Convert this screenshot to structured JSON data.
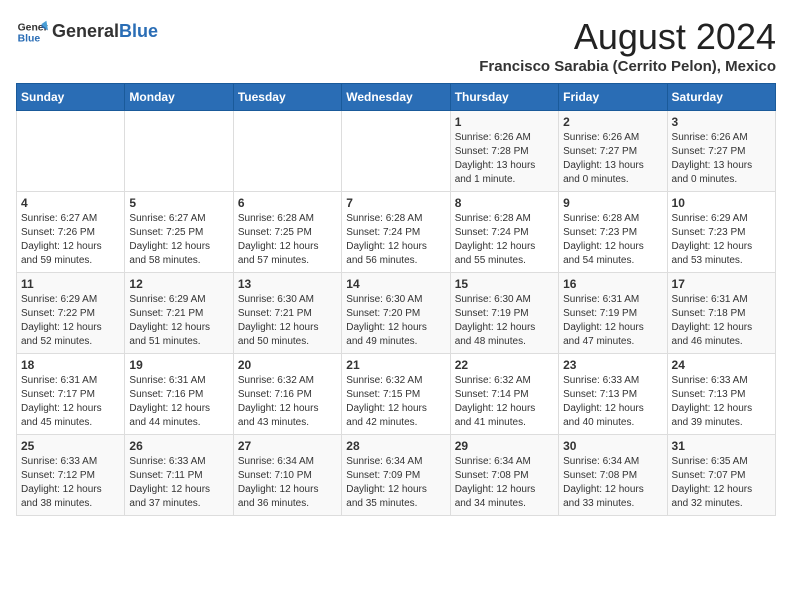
{
  "header": {
    "logo_general": "General",
    "logo_blue": "Blue",
    "month_year": "August 2024",
    "location": "Francisco Sarabia (Cerrito Pelon), Mexico"
  },
  "calendar": {
    "days_of_week": [
      "Sunday",
      "Monday",
      "Tuesday",
      "Wednesday",
      "Thursday",
      "Friday",
      "Saturday"
    ],
    "weeks": [
      [
        {
          "day": "",
          "info": ""
        },
        {
          "day": "",
          "info": ""
        },
        {
          "day": "",
          "info": ""
        },
        {
          "day": "",
          "info": ""
        },
        {
          "day": "1",
          "info": "Sunrise: 6:26 AM\nSunset: 7:28 PM\nDaylight: 13 hours\nand 1 minute."
        },
        {
          "day": "2",
          "info": "Sunrise: 6:26 AM\nSunset: 7:27 PM\nDaylight: 13 hours\nand 0 minutes."
        },
        {
          "day": "3",
          "info": "Sunrise: 6:26 AM\nSunset: 7:27 PM\nDaylight: 13 hours\nand 0 minutes."
        }
      ],
      [
        {
          "day": "4",
          "info": "Sunrise: 6:27 AM\nSunset: 7:26 PM\nDaylight: 12 hours\nand 59 minutes."
        },
        {
          "day": "5",
          "info": "Sunrise: 6:27 AM\nSunset: 7:25 PM\nDaylight: 12 hours\nand 58 minutes."
        },
        {
          "day": "6",
          "info": "Sunrise: 6:28 AM\nSunset: 7:25 PM\nDaylight: 12 hours\nand 57 minutes."
        },
        {
          "day": "7",
          "info": "Sunrise: 6:28 AM\nSunset: 7:24 PM\nDaylight: 12 hours\nand 56 minutes."
        },
        {
          "day": "8",
          "info": "Sunrise: 6:28 AM\nSunset: 7:24 PM\nDaylight: 12 hours\nand 55 minutes."
        },
        {
          "day": "9",
          "info": "Sunrise: 6:28 AM\nSunset: 7:23 PM\nDaylight: 12 hours\nand 54 minutes."
        },
        {
          "day": "10",
          "info": "Sunrise: 6:29 AM\nSunset: 7:23 PM\nDaylight: 12 hours\nand 53 minutes."
        }
      ],
      [
        {
          "day": "11",
          "info": "Sunrise: 6:29 AM\nSunset: 7:22 PM\nDaylight: 12 hours\nand 52 minutes."
        },
        {
          "day": "12",
          "info": "Sunrise: 6:29 AM\nSunset: 7:21 PM\nDaylight: 12 hours\nand 51 minutes."
        },
        {
          "day": "13",
          "info": "Sunrise: 6:30 AM\nSunset: 7:21 PM\nDaylight: 12 hours\nand 50 minutes."
        },
        {
          "day": "14",
          "info": "Sunrise: 6:30 AM\nSunset: 7:20 PM\nDaylight: 12 hours\nand 49 minutes."
        },
        {
          "day": "15",
          "info": "Sunrise: 6:30 AM\nSunset: 7:19 PM\nDaylight: 12 hours\nand 48 minutes."
        },
        {
          "day": "16",
          "info": "Sunrise: 6:31 AM\nSunset: 7:19 PM\nDaylight: 12 hours\nand 47 minutes."
        },
        {
          "day": "17",
          "info": "Sunrise: 6:31 AM\nSunset: 7:18 PM\nDaylight: 12 hours\nand 46 minutes."
        }
      ],
      [
        {
          "day": "18",
          "info": "Sunrise: 6:31 AM\nSunset: 7:17 PM\nDaylight: 12 hours\nand 45 minutes."
        },
        {
          "day": "19",
          "info": "Sunrise: 6:31 AM\nSunset: 7:16 PM\nDaylight: 12 hours\nand 44 minutes."
        },
        {
          "day": "20",
          "info": "Sunrise: 6:32 AM\nSunset: 7:16 PM\nDaylight: 12 hours\nand 43 minutes."
        },
        {
          "day": "21",
          "info": "Sunrise: 6:32 AM\nSunset: 7:15 PM\nDaylight: 12 hours\nand 42 minutes."
        },
        {
          "day": "22",
          "info": "Sunrise: 6:32 AM\nSunset: 7:14 PM\nDaylight: 12 hours\nand 41 minutes."
        },
        {
          "day": "23",
          "info": "Sunrise: 6:33 AM\nSunset: 7:13 PM\nDaylight: 12 hours\nand 40 minutes."
        },
        {
          "day": "24",
          "info": "Sunrise: 6:33 AM\nSunset: 7:13 PM\nDaylight: 12 hours\nand 39 minutes."
        }
      ],
      [
        {
          "day": "25",
          "info": "Sunrise: 6:33 AM\nSunset: 7:12 PM\nDaylight: 12 hours\nand 38 minutes."
        },
        {
          "day": "26",
          "info": "Sunrise: 6:33 AM\nSunset: 7:11 PM\nDaylight: 12 hours\nand 37 minutes."
        },
        {
          "day": "27",
          "info": "Sunrise: 6:34 AM\nSunset: 7:10 PM\nDaylight: 12 hours\nand 36 minutes."
        },
        {
          "day": "28",
          "info": "Sunrise: 6:34 AM\nSunset: 7:09 PM\nDaylight: 12 hours\nand 35 minutes."
        },
        {
          "day": "29",
          "info": "Sunrise: 6:34 AM\nSunset: 7:08 PM\nDaylight: 12 hours\nand 34 minutes."
        },
        {
          "day": "30",
          "info": "Sunrise: 6:34 AM\nSunset: 7:08 PM\nDaylight: 12 hours\nand 33 minutes."
        },
        {
          "day": "31",
          "info": "Sunrise: 6:35 AM\nSunset: 7:07 PM\nDaylight: 12 hours\nand 32 minutes."
        }
      ]
    ]
  }
}
